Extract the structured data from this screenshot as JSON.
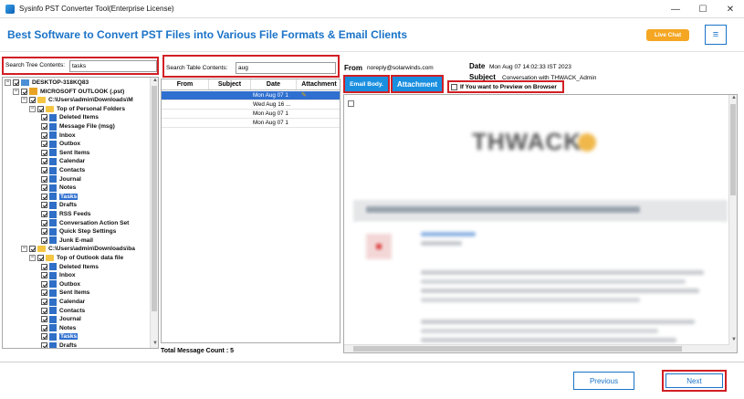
{
  "window": {
    "title": "Sysinfo PST Converter Tool(Enterprise License)",
    "controls": {
      "minimize": "—",
      "maximize": "☐",
      "close": "✕"
    }
  },
  "header": {
    "title": "Best Software to Convert PST Files into Various File Formats & Email Clients",
    "live_chat": "Live Chat",
    "menu_icon": "≡",
    "accent": "#1a73c8",
    "live_chat_color": "#f5a623"
  },
  "tree_search": {
    "label": "Search Tree Contents:",
    "value": "tasks"
  },
  "tree": {
    "items": [
      {
        "label": "DESKTOP-318KQ83",
        "level": 0,
        "icon": "computer-icon",
        "expander": "−"
      },
      {
        "label": "MICROSOFT OUTLOOK (.pst)",
        "level": 1,
        "icon": "outlook-icon",
        "expander": "−"
      },
      {
        "label": "C:\\Users\\admin\\Downloads\\M",
        "level": 2,
        "icon": "folder-icon",
        "expander": "−"
      },
      {
        "label": "Top of Personal Folders",
        "level": 3,
        "icon": "folder-icon",
        "expander": "−"
      },
      {
        "label": "Deleted Items",
        "level": 4,
        "icon": "folder-icon"
      },
      {
        "label": "Message File (msg)",
        "level": 4,
        "icon": "folder-icon"
      },
      {
        "label": "Inbox",
        "level": 4,
        "icon": "folder-icon"
      },
      {
        "label": "Outbox",
        "level": 4,
        "icon": "folder-icon"
      },
      {
        "label": "Sent Items",
        "level": 4,
        "icon": "folder-icon"
      },
      {
        "label": "Calendar",
        "level": 4,
        "icon": "folder-icon"
      },
      {
        "label": "Contacts",
        "level": 4,
        "icon": "folder-icon"
      },
      {
        "label": "Journal",
        "level": 4,
        "icon": "folder-icon"
      },
      {
        "label": "Notes",
        "level": 4,
        "icon": "folder-icon"
      },
      {
        "label": "Tasks",
        "level": 4,
        "icon": "folder-icon",
        "selected": true
      },
      {
        "label": "Drafts",
        "level": 4,
        "icon": "folder-icon"
      },
      {
        "label": "RSS Feeds",
        "level": 4,
        "icon": "folder-icon"
      },
      {
        "label": "Conversation Action Set",
        "level": 4,
        "icon": "folder-icon"
      },
      {
        "label": "Quick Step Settings",
        "level": 4,
        "icon": "folder-icon"
      },
      {
        "label": "Junk E-mail",
        "level": 4,
        "icon": "folder-icon"
      },
      {
        "label": "C:\\Users\\admin\\Downloads\\ba",
        "level": 2,
        "icon": "folder-icon",
        "expander": "−"
      },
      {
        "label": "Top of Outlook data file",
        "level": 3,
        "icon": "folder-icon",
        "expander": "−"
      },
      {
        "label": "Deleted Items",
        "level": 4,
        "icon": "folder-icon"
      },
      {
        "label": "Inbox",
        "level": 4,
        "icon": "folder-icon"
      },
      {
        "label": "Outbox",
        "level": 4,
        "icon": "folder-icon"
      },
      {
        "label": "Sent Items",
        "level": 4,
        "icon": "folder-icon"
      },
      {
        "label": "Calendar",
        "level": 4,
        "icon": "folder-icon"
      },
      {
        "label": "Contacts",
        "level": 4,
        "icon": "folder-icon"
      },
      {
        "label": "Journal",
        "level": 4,
        "icon": "folder-icon"
      },
      {
        "label": "Notes",
        "level": 4,
        "icon": "folder-icon"
      },
      {
        "label": "Tasks",
        "level": 4,
        "icon": "folder-icon",
        "selected": true
      },
      {
        "label": "Drafts",
        "level": 4,
        "icon": "folder-icon"
      }
    ]
  },
  "table_search": {
    "label": "Search Table Contents:",
    "value": "aug"
  },
  "table": {
    "columns": [
      "From",
      "Subject",
      "Date",
      "Attachment"
    ],
    "rows": [
      {
        "from": "",
        "subject": "",
        "date": "Mon Aug 07 1",
        "attachment": true,
        "selected": true
      },
      {
        "from": "",
        "subject": "",
        "date": "Wed Aug 16 ...",
        "attachment": false
      },
      {
        "from": "",
        "subject": "",
        "date": "Mon Aug 07 1",
        "attachment": false
      },
      {
        "from": "",
        "subject": "",
        "date": "Mon Aug 07 1",
        "attachment": false
      }
    ],
    "total_label": "Total Message Count : 5"
  },
  "preview": {
    "from_label": "From",
    "from_value": "noreply@solarwinds.com",
    "date_label": "Date",
    "date_value": "Mon Aug 07 14:02:33 IST 2023",
    "subject_label": "Subject",
    "subject_value": "Conversation with THWACK_Admin",
    "email_body_btn": "Email Body.",
    "attachment_btn": "Attachment",
    "preview_checkbox": "If You want to Preview on Browser",
    "logo_text": "THWACK"
  },
  "footer": {
    "previous": "Previous",
    "next": "Next"
  }
}
